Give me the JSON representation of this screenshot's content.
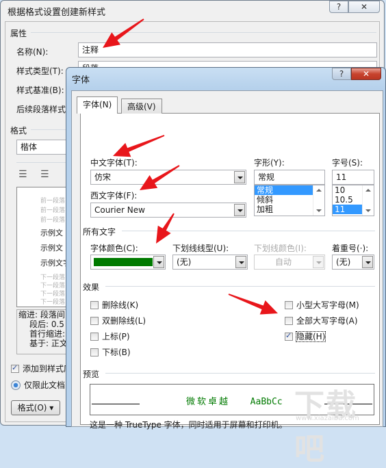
{
  "back_dialog": {
    "title": "根据格式设置创建新样式",
    "help_icon": "question-icon",
    "close_icon": "close-icon",
    "properties": {
      "section": "属性",
      "name_label": "名称(N):",
      "name_value": "注释",
      "style_type_label": "样式类型(T):",
      "style_type_value": "段落",
      "style_based_label": "样式基准(B):",
      "following_label": "后续段落样式"
    },
    "format": {
      "section": "格式",
      "font_value": "楷体"
    },
    "preview_lines": {
      "prev": [
        "前一段落",
        "前一段落",
        "前一段落"
      ],
      "sample": [
        "示例文",
        "示例文",
        "示例文字"
      ],
      "next": [
        "下一段落",
        "下一段落",
        "下一段落",
        "下一段落"
      ]
    },
    "description": [
      "缩进: 段落间",
      "段后: 0.5",
      "首行缩进:",
      "基于: 正文"
    ],
    "add_to_gallery": {
      "label": "添加到样式库",
      "checked": true
    },
    "only_this_doc": {
      "label": "仅限此文档",
      "selected": true
    },
    "format_button": "格式(O) ▾"
  },
  "font_dialog": {
    "title": "字体",
    "help_icon": "question-icon",
    "close_icon": "close-icon",
    "tabs": [
      {
        "label": "字体(N)",
        "active": true
      },
      {
        "label": "高级(V)",
        "active": false
      }
    ],
    "chinese_font": {
      "label": "中文字体(T):",
      "value": "仿宋"
    },
    "western_font": {
      "label": "西文字体(F):",
      "value": "Courier New"
    },
    "font_style": {
      "label": "字形(Y):",
      "value": "常规",
      "options": [
        "常规",
        "倾斜",
        "加粗"
      ],
      "selected": "常规"
    },
    "font_size": {
      "label": "字号(S):",
      "value": "11",
      "options": [
        "10",
        "10.5",
        "11"
      ],
      "selected": "11"
    },
    "all_text": {
      "section": "所有文字",
      "font_color_label": "字体颜色(C):",
      "font_color": "#007a00",
      "underline_style_label": "下划线线型(U):",
      "underline_style_value": "(无)",
      "underline_color_label": "下划线颜色(I):",
      "underline_color_value": "自动",
      "emphasis_label": "着重号(·):",
      "emphasis_value": "(无)"
    },
    "effects": {
      "section": "效果",
      "left": [
        {
          "label": "删除线(K)",
          "checked": false
        },
        {
          "label": "双删除线(L)",
          "checked": false
        },
        {
          "label": "上标(P)",
          "checked": false
        },
        {
          "label": "下标(B)",
          "checked": false
        }
      ],
      "right": [
        {
          "label": "小型大写字母(M)",
          "checked": false
        },
        {
          "label": "全部大写字母(A)",
          "checked": false
        },
        {
          "label": "隐藏(H)",
          "checked": true
        }
      ]
    },
    "preview": {
      "section": "预览",
      "sample_cn": "微软卓越",
      "sample_en": "AaBbCc",
      "note": "这是一种 TrueType 字体，同时适用于屏幕和打印机。"
    }
  },
  "watermark": {
    "text": "下载吧",
    "url": "www.xiazaiba.com"
  },
  "annotation_color": "#e8161b"
}
